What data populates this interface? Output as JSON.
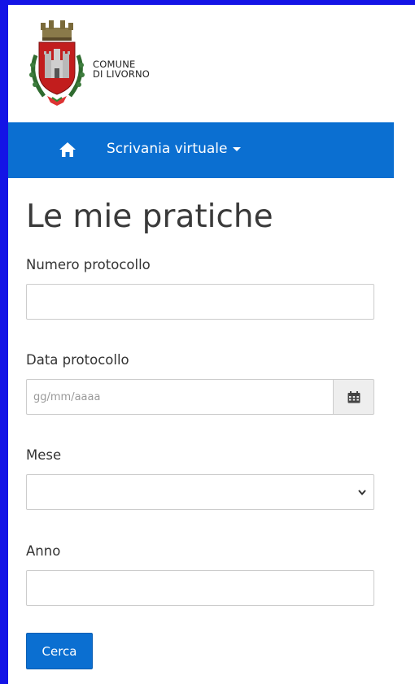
{
  "header": {
    "logo_line1": "COMUNE",
    "logo_line2": "DI LIVORNO"
  },
  "navbar": {
    "home_icon": "home-icon",
    "menu_label": "Scrivania virtuale"
  },
  "page": {
    "title": "Le mie pratiche"
  },
  "form": {
    "numero_protocollo": {
      "label": "Numero protocollo",
      "value": ""
    },
    "data_protocollo": {
      "label": "Data protocollo",
      "value": "",
      "placeholder": "gg/mm/aaaa",
      "icon": "calendar-icon"
    },
    "mese": {
      "label": "Mese",
      "value": "",
      "icon": "chevron-down-icon"
    },
    "anno": {
      "label": "Anno",
      "value": ""
    },
    "submit_label": "Cerca"
  },
  "colors": {
    "navbar": "#0b6fd1",
    "frame": "#1414e6",
    "button": "#0b6fd1"
  }
}
